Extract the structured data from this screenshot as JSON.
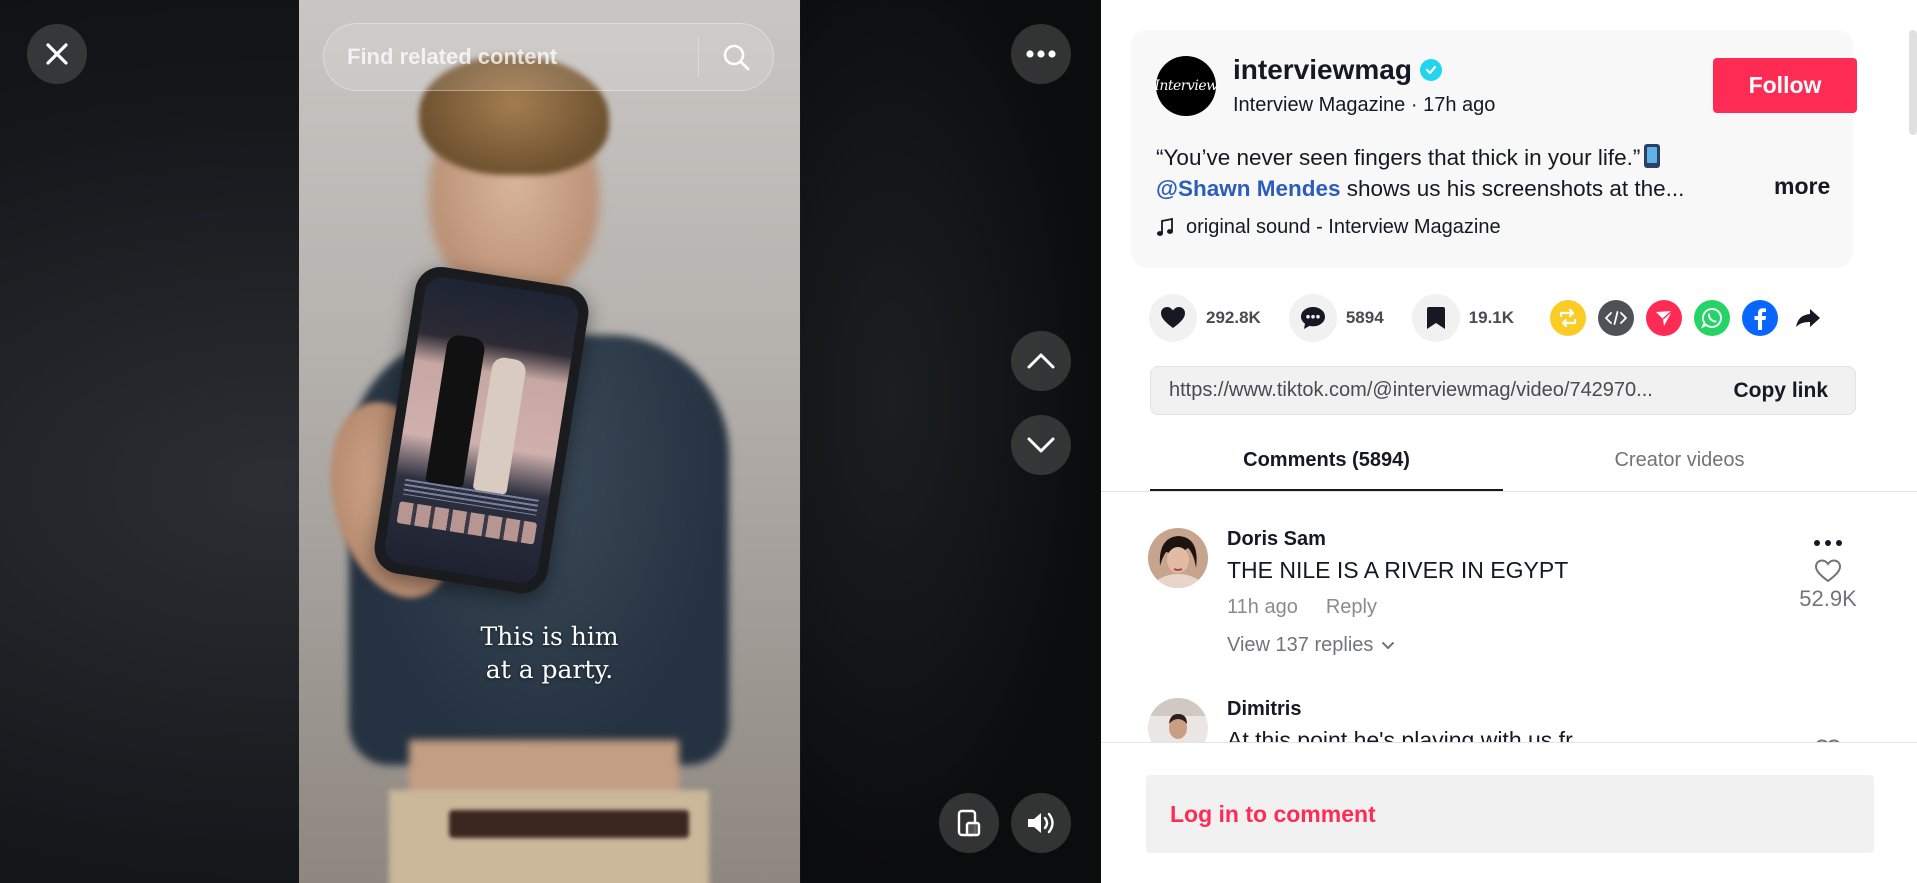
{
  "video": {
    "search_placeholder": "Find related content",
    "caption_line1": "This is him",
    "caption_line2": "at a party."
  },
  "author": {
    "avatar_text": "Interview",
    "username": "interviewmag",
    "display_name": "Interview Magazine",
    "time_ago": "17h ago",
    "follow_label": "Follow"
  },
  "description": {
    "line1": "“You’ve never seen fingers that thick in your life.”",
    "mention": "@Shawn Mendes",
    "line2_rest": " shows us his screenshots at the...",
    "more_label": "more"
  },
  "music": {
    "label": "original sound - Interview Magazine"
  },
  "actions": {
    "likes": "292.8K",
    "comments": "5894",
    "saves": "19.1K"
  },
  "share_icons": [
    "repost-icon",
    "embed-icon",
    "send-to-friends-icon",
    "whatsapp-icon",
    "facebook-icon",
    "share-arrow-icon"
  ],
  "link": {
    "url": "https://www.tiktok.com/@interviewmag/video/742970...",
    "copy_label": "Copy link"
  },
  "tabs": [
    {
      "label": "Comments (5894)",
      "active": true
    },
    {
      "label": "Creator videos",
      "active": false
    }
  ],
  "comments": [
    {
      "user": "Doris Sam",
      "text": "THE NILE IS A RIVER IN EGYPT",
      "time": "11h ago",
      "reply_label": "Reply",
      "view_replies": "View 137 replies",
      "likes": "52.9K"
    },
    {
      "user": "Dimitris",
      "text": "At this point he's playing with us fr"
    }
  ],
  "login_prompt": "Log in to comment",
  "colors": {
    "brand_red": "#fe2c55",
    "verified_cyan": "#20d5ec",
    "mention_blue": "#2b5db9"
  }
}
